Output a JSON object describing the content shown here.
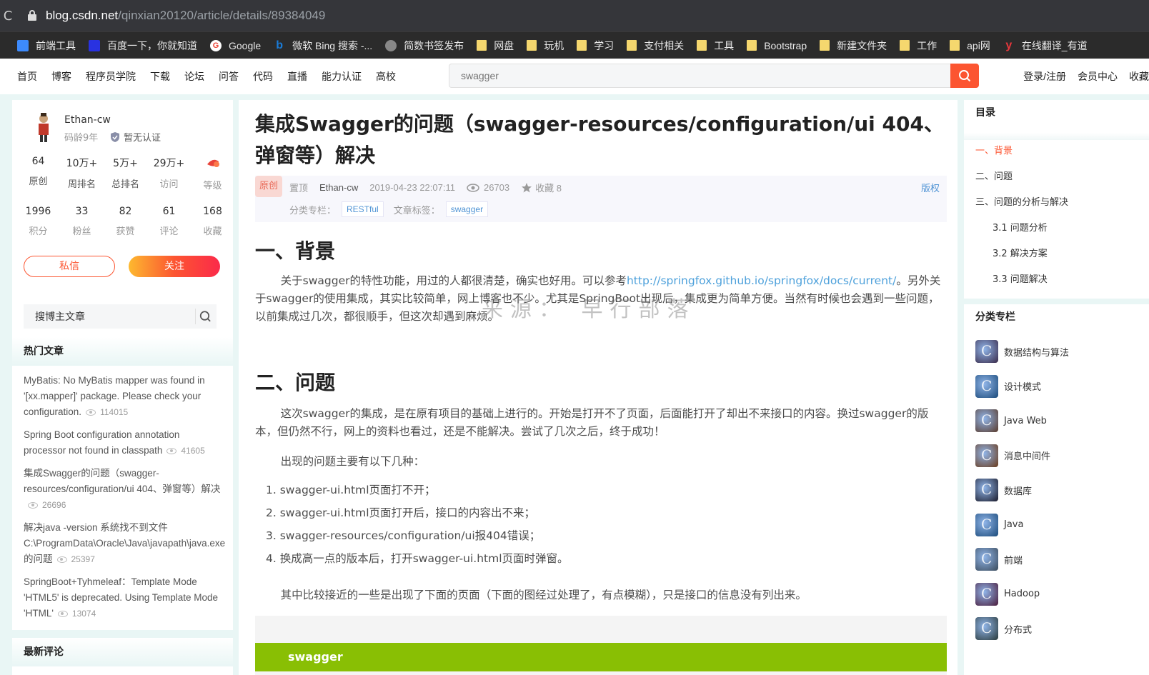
{
  "browser": {
    "url_host": "blog.csdn.net",
    "url_path": "/qinxian20120/article/details/89384049",
    "bookmarks": [
      {
        "label": "前端工具",
        "icon": "frontend-tools-icon",
        "color": "#3d8bfd"
      },
      {
        "label": "百度一下，你就知道",
        "icon": "baidu-icon",
        "color": "#2932e1"
      },
      {
        "label": "Google",
        "icon": "google-icon",
        "color": "#ea4335"
      },
      {
        "label": "微软 Bing 搜索 -...",
        "icon": "bing-icon",
        "color": "#1a7bd6"
      },
      {
        "label": "简数书签发布",
        "icon": "globe-icon",
        "color": "#888888"
      },
      {
        "label": "网盘",
        "icon": "folder-icon"
      },
      {
        "label": "玩机",
        "icon": "folder-icon"
      },
      {
        "label": "学习",
        "icon": "folder-icon"
      },
      {
        "label": "支付相关",
        "icon": "folder-icon"
      },
      {
        "label": "工具",
        "icon": "folder-icon"
      },
      {
        "label": "Bootstrap",
        "icon": "folder-icon"
      },
      {
        "label": "新建文件夹",
        "icon": "folder-icon"
      },
      {
        "label": "工作",
        "icon": "folder-icon"
      },
      {
        "label": "api网",
        "icon": "folder-icon"
      },
      {
        "label": "在线翻译_有道",
        "icon": "youdao-icon",
        "color": "#e8373c"
      }
    ]
  },
  "nav": {
    "links": [
      "首页",
      "博客",
      "程序员学院",
      "下载",
      "论坛",
      "问答",
      "代码",
      "直播",
      "能力认证",
      "高校"
    ],
    "search_placeholder": "swagger",
    "right": [
      "登录/注册",
      "会员中心",
      "收藏"
    ]
  },
  "profile": {
    "name": "Ethan-cw",
    "age": "码龄9年",
    "cert": "暂无认证",
    "stats_row1": [
      {
        "value": "64",
        "label": "原创"
      },
      {
        "value": "10万+",
        "label": "周排名"
      },
      {
        "value": "5万+",
        "label": "总排名"
      },
      {
        "value": "29万+",
        "label": "访问"
      },
      {
        "value": "",
        "label": "等级"
      }
    ],
    "stats_row2": [
      {
        "value": "1996",
        "label": "积分"
      },
      {
        "value": "33",
        "label": "粉丝"
      },
      {
        "value": "82",
        "label": "获赞"
      },
      {
        "value": "61",
        "label": "评论"
      },
      {
        "value": "168",
        "label": "收藏"
      }
    ],
    "msg_label": "私信",
    "follow_label": "关注"
  },
  "blog_search": {
    "value": "搜博主文章"
  },
  "hot": {
    "title": "热门文章",
    "items": [
      {
        "text": "MyBatis: No MyBatis mapper was found in '[xx.mapper]' package. Please check your configuration.",
        "views": "114015"
      },
      {
        "text": "Spring Boot configuration annotation processor not found in classpath",
        "views": "41605"
      },
      {
        "text": "集成Swagger的问题（swagger-resources/configuration/ui 404、弹窗等）解决",
        "views": "26696"
      },
      {
        "text": "解决java -version 系统找不到文件C:\\ProgramData\\Oracle\\Java\\javapath\\java.exe的问题",
        "views": "25397"
      },
      {
        "text": "SpringBoot+Tyhmeleaf：Template Mode 'HTML5' is deprecated. Using Template Mode 'HTML'",
        "views": "13074"
      }
    ]
  },
  "comments": {
    "title": "最新评论"
  },
  "article": {
    "title": "集成Swagger的问题（swagger-resources/configuration/ui 404、弹窗等）解决",
    "orig_tag": "原创",
    "pinned": "置顶",
    "author": "Ethan-cw",
    "date": "2019-04-23 22:07:11",
    "views": "26703",
    "favorites": "收藏 8",
    "copyright": "版权",
    "column_label": "分类专栏：",
    "column": "RESTful",
    "tags_label": "文章标签：",
    "tag": "swagger",
    "sec1": "一、背景",
    "sec1_p_a": "关于swagger的特性功能，用过的人都很清楚，确实也好用。可以参考",
    "sec1_link": "http://springfox.github.io/springfox/docs/current/",
    "sec1_p_b": "。另外关于swagger的使用集成，其实比较简单，网上博客也不少。尤其是SpringBoot出现后，集成更为简单方便。当然有时候也会遇到一些问题，以前集成过几次，都很顺手，但这次却遇到麻烦。",
    "watermark": "来源：  早行部落",
    "sec2": "二、问题",
    "sec2_p1": "这次swagger的集成，是在原有项目的基础上进行的。开始是打开不了页面，后面能打开了却出不来接口的内容。换过swagger的版本，但仍然不行，网上的资料也看过，还是不能解决。尝试了几次之后，终于成功！",
    "sec2_p2": "出现的问题主要有以下几种：",
    "issues": [
      "1. swagger-ui.html页面打不开；",
      "2. swagger-ui.html页面打开后，接口的内容出不来；",
      "3. swagger-resources/configuration/ui报404错误；",
      "4. 换成高一点的版本后，打开swagger-ui.html页面时弹窗。"
    ],
    "sec2_p3": "其中比较接近的一些是出现了下面的页面（下面的图经过处理了，有点模糊），只是接口的信息没有列出来。",
    "img_logo": "swagger"
  },
  "toc": {
    "title": "目录",
    "items": [
      {
        "label": "一、背景",
        "active": true
      },
      {
        "label": "二、问题"
      },
      {
        "label": "三、问题的分析与解决"
      },
      {
        "label": "3.1 问题分析",
        "sub": true
      },
      {
        "label": "3.2 解决方案",
        "sub": true
      },
      {
        "label": "3.3 问题解决",
        "sub": true
      }
    ]
  },
  "categories": {
    "title": "分类专栏",
    "items": [
      {
        "label": "数据结构与算法",
        "color": "#3a2a4a"
      },
      {
        "label": "设计模式",
        "color": "#1a4a7a"
      },
      {
        "label": "Java Web",
        "color": "#5a3a2a"
      },
      {
        "label": "消息中间件",
        "color": "#6a3a1a"
      },
      {
        "label": "数据库",
        "color": "#1a1a2a"
      },
      {
        "label": "Java",
        "color": "#1a4a7a"
      },
      {
        "label": "前端",
        "color": "#3a4a5a"
      },
      {
        "label": "Hadoop",
        "color": "#4a1a3a"
      },
      {
        "label": "分布式",
        "color": "#2a3a3a"
      }
    ]
  }
}
